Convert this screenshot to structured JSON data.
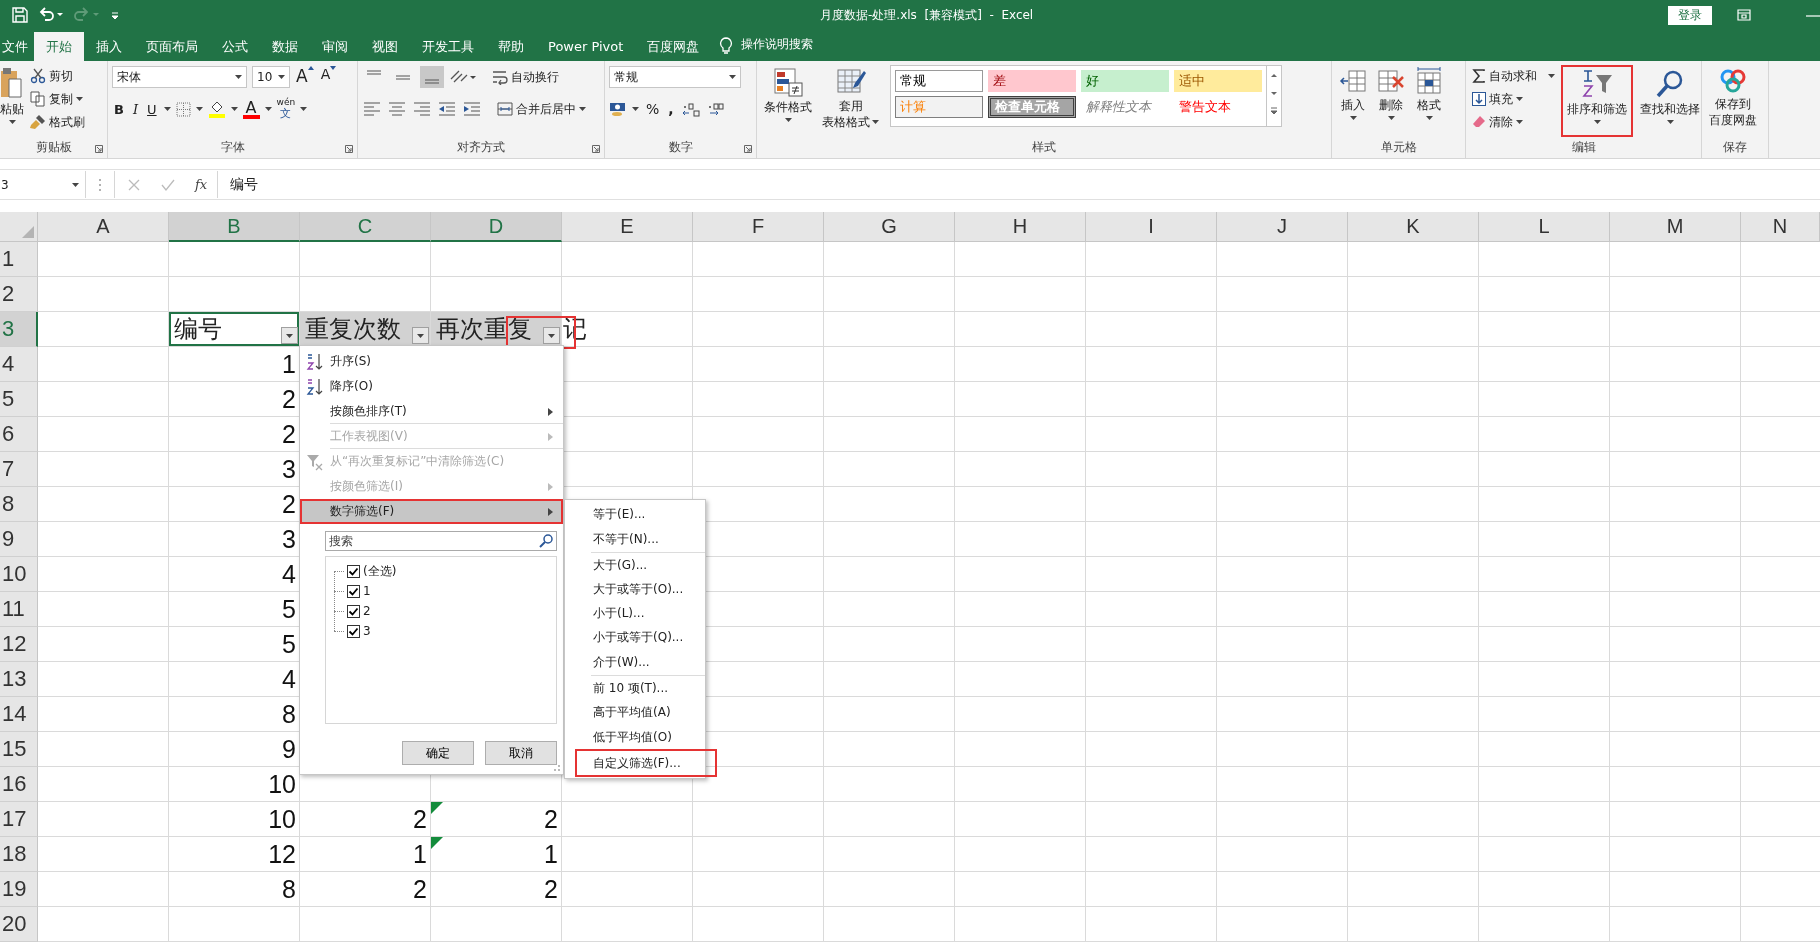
{
  "title_bar": {
    "title": "月度数据-处理.xls  [兼容模式]  -  Excel",
    "account_button": "登录"
  },
  "tabs": [
    {
      "label": "文件",
      "selected": false
    },
    {
      "label": "开始",
      "selected": true
    },
    {
      "label": "插入",
      "selected": false
    },
    {
      "label": "页面布局",
      "selected": false
    },
    {
      "label": "公式",
      "selected": false
    },
    {
      "label": "数据",
      "selected": false
    },
    {
      "label": "审阅",
      "selected": false
    },
    {
      "label": "视图",
      "selected": false
    },
    {
      "label": "开发工具",
      "selected": false
    },
    {
      "label": "帮助",
      "selected": false
    },
    {
      "label": "Power Pivot",
      "selected": false
    },
    {
      "label": "百度网盘",
      "selected": false
    }
  ],
  "tell_me": "操作说明搜索",
  "ribbon": {
    "clipboard": {
      "paste": "粘贴",
      "cut": "剪切",
      "copy": "复制",
      "format_painter": "格式刷",
      "label": "剪贴板"
    },
    "font": {
      "font_name": "宋体",
      "font_size": "10",
      "grow": "A",
      "shrink": "A",
      "bold": "B",
      "italic": "I",
      "underline": "U",
      "font_color": "A",
      "phonetic_top": "wén",
      "phonetic_bottom": "文",
      "label": "字体"
    },
    "alignment": {
      "vertical_align": [
        {
          "selected": false
        },
        {
          "selected": false
        },
        {
          "selected": true
        }
      ],
      "wrap_text": "自动换行",
      "merge_center": "合并后居中",
      "label": "对齐方式"
    },
    "number": {
      "format": "常规",
      "percent": "%",
      "comma": ",",
      "label": "数字"
    },
    "styles": {
      "conditional_format": "条件格式",
      "format_as_table": [
        "套用",
        "表格格式"
      ],
      "gallery": [
        {
          "label": "常规",
          "kind": "normal"
        },
        {
          "label": "差",
          "kind": "bad"
        },
        {
          "label": "好",
          "kind": "good"
        },
        {
          "label": "适中",
          "kind": "neutral"
        },
        {
          "label": "计算",
          "kind": "calculation"
        },
        {
          "label": "检查单元格",
          "kind": "check"
        },
        {
          "label": "解释性文本",
          "kind": "explanatory"
        },
        {
          "label": "警告文本",
          "kind": "warning"
        }
      ],
      "label": "样式"
    },
    "cells": {
      "buttons": [
        {
          "label": "插入",
          "kind": "insert"
        },
        {
          "label": "删除",
          "kind": "delete"
        },
        {
          "label": "格式",
          "kind": "format"
        }
      ],
      "label": "单元格"
    },
    "editing": {
      "autosum": "自动求和",
      "fill": "填充",
      "clear": "清除",
      "sort_filter": {
        "label": "排序和筛选",
        "annotated": true
      },
      "find_select": {
        "label": "查找和选择",
        "annotated": false
      },
      "label": "编辑"
    },
    "save": {
      "button": [
        "保存到",
        "百度网盘"
      ],
      "label": "保存"
    }
  },
  "formula_bar": {
    "name_box": "3",
    "function_label": "fx",
    "content": "编号"
  },
  "sheet": {
    "columns": [
      {
        "label": "A",
        "selected": false
      },
      {
        "label": "B",
        "selected": true
      },
      {
        "label": "C",
        "selected": true
      },
      {
        "label": "D",
        "selected": true
      },
      {
        "label": "E",
        "selected": false
      },
      {
        "label": "F",
        "selected": false
      },
      {
        "label": "G",
        "selected": false
      },
      {
        "label": "H",
        "selected": false
      },
      {
        "label": "I",
        "selected": false
      },
      {
        "label": "J",
        "selected": false
      },
      {
        "label": "K",
        "selected": false
      },
      {
        "label": "L",
        "selected": false
      },
      {
        "label": "M",
        "selected": false
      },
      {
        "label": "N",
        "selected": false
      }
    ],
    "rows": [
      {
        "header": "1",
        "selected": false
      },
      {
        "header": "2",
        "selected": false
      },
      {
        "header": "3",
        "selected": true,
        "kind": "header",
        "cells": {
          "b": {
            "text": "编号",
            "annotated": false
          },
          "c": {
            "text": "重复次数",
            "annotated": false
          },
          "d": {
            "text": "再次重复",
            "overflow_text": "记",
            "annotated": true
          }
        }
      },
      {
        "header": "4",
        "selected": false,
        "kind": "data",
        "cells": {
          "b": {
            "text": "1",
            "error": false
          }
        }
      },
      {
        "header": "5",
        "selected": false,
        "kind": "data",
        "cells": {
          "b": {
            "text": "2",
            "error": false
          }
        }
      },
      {
        "header": "6",
        "selected": false,
        "kind": "data",
        "cells": {
          "b": {
            "text": "2",
            "error": false
          }
        }
      },
      {
        "header": "7",
        "selected": false,
        "kind": "data",
        "cells": {
          "b": {
            "text": "3",
            "error": false
          }
        }
      },
      {
        "header": "8",
        "selected": false,
        "kind": "data",
        "cells": {
          "b": {
            "text": "2",
            "error": false
          }
        }
      },
      {
        "header": "9",
        "selected": false,
        "kind": "data",
        "cells": {
          "b": {
            "text": "3",
            "error": false
          }
        }
      },
      {
        "header": "10",
        "selected": false,
        "kind": "data",
        "cells": {
          "b": {
            "text": "4",
            "error": false
          }
        }
      },
      {
        "header": "11",
        "selected": false,
        "kind": "data",
        "cells": {
          "b": {
            "text": "5",
            "error": false
          }
        }
      },
      {
        "header": "12",
        "selected": false,
        "kind": "data",
        "cells": {
          "b": {
            "text": "5",
            "error": false
          }
        }
      },
      {
        "header": "13",
        "selected": false,
        "kind": "data",
        "cells": {
          "b": {
            "text": "4",
            "error": false
          }
        }
      },
      {
        "header": "14",
        "selected": false,
        "kind": "data",
        "cells": {
          "b": {
            "text": "8",
            "error": false
          }
        }
      },
      {
        "header": "15",
        "selected": false,
        "kind": "data",
        "cells": {
          "b": {
            "text": "9",
            "error": false
          }
        }
      },
      {
        "header": "16",
        "selected": false,
        "kind": "data",
        "cells": {
          "b": {
            "text": "10",
            "error": false
          }
        }
      },
      {
        "header": "17",
        "selected": false,
        "kind": "data",
        "cells": {
          "b": {
            "text": "10",
            "error": false
          },
          "c": {
            "text": "2",
            "error": false
          },
          "d": {
            "text": "2",
            "error": true
          }
        }
      },
      {
        "header": "18",
        "selected": false,
        "kind": "data",
        "cells": {
          "b": {
            "text": "12",
            "error": false
          },
          "c": {
            "text": "1",
            "error": false
          },
          "d": {
            "text": "1",
            "error": true
          }
        }
      },
      {
        "header": "19",
        "selected": false,
        "kind": "data",
        "cells": {
          "b": {
            "text": "8",
            "error": false
          },
          "c": {
            "text": "2",
            "error": false
          },
          "d": {
            "text": "2",
            "error": false
          }
        }
      },
      {
        "header": "20",
        "selected": false
      }
    ]
  },
  "filter_menu": {
    "items": [
      {
        "label": "升序(S)",
        "kind": "sort_ascending",
        "disabled": false,
        "submenu": false,
        "selected": false,
        "annotated": false,
        "divider_below": false
      },
      {
        "label": "降序(O)",
        "kind": "sort_descending",
        "disabled": false,
        "submenu": false,
        "selected": false,
        "annotated": false,
        "divider_below": false
      },
      {
        "label": "按颜色排序(T)",
        "kind": "plain",
        "disabled": false,
        "submenu": true,
        "selected": false,
        "annotated": false,
        "divider_below": true
      },
      {
        "label": "工作表视图(V)",
        "kind": "plain",
        "disabled": true,
        "submenu": true,
        "selected": false,
        "annotated": false,
        "divider_below": true
      },
      {
        "label": "从“再次重复标记”中清除筛选(C)",
        "kind": "clear_filter",
        "disabled": true,
        "submenu": false,
        "selected": false,
        "annotated": false,
        "divider_below": false
      },
      {
        "label": "按颜色筛选(I)",
        "kind": "plain",
        "disabled": true,
        "submenu": true,
        "selected": false,
        "annotated": false,
        "divider_below": false
      },
      {
        "label": "数字筛选(F)",
        "kind": "plain",
        "disabled": false,
        "submenu": true,
        "selected": true,
        "annotated": true,
        "divider_below": false
      }
    ],
    "search": {
      "placeholder": "搜索"
    },
    "values": [
      {
        "label": "(全选)",
        "checked": true,
        "children": [
          {
            "label": "1",
            "checked": true
          },
          {
            "label": "2",
            "checked": true
          },
          {
            "label": "3",
            "checked": true
          }
        ]
      }
    ],
    "buttons": [
      "确定",
      "取消"
    ]
  },
  "number_filter_submenu": {
    "items": [
      {
        "label": "等于(E)...",
        "annotated": false,
        "divider_below": false
      },
      {
        "label": "不等于(N)...",
        "annotated": false,
        "divider_below": true
      },
      {
        "label": "大于(G)...",
        "annotated": false,
        "divider_below": false
      },
      {
        "label": "大于或等于(O)...",
        "annotated": false,
        "divider_below": false
      },
      {
        "label": "小于(L)...",
        "annotated": false,
        "divider_below": false
      },
      {
        "label": "小于或等于(Q)...",
        "annotated": false,
        "divider_below": false
      },
      {
        "label": "介于(W)...",
        "annotated": false,
        "divider_below": true
      },
      {
        "label": "前 10 项(T)...",
        "annotated": false,
        "divider_below": false
      },
      {
        "label": "高于平均值(A)",
        "annotated": false,
        "divider_below": false
      },
      {
        "label": "低于平均值(O)",
        "annotated": false,
        "divider_below": true
      },
      {
        "label": "自定义筛选(F)...",
        "annotated": true,
        "divider_below": false
      }
    ]
  }
}
